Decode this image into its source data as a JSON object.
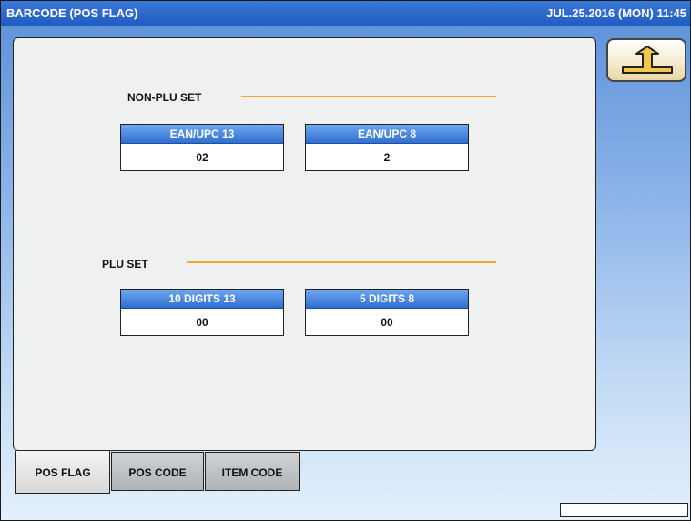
{
  "header": {
    "title": "BARCODE (POS FLAG)",
    "datetime": "JUL.25.2016 (MON)  11:45"
  },
  "non_plu": {
    "label": "NON-PLU SET",
    "fields": [
      {
        "label": "EAN/UPC 13",
        "value": "02"
      },
      {
        "label": "EAN/UPC 8",
        "value": "2"
      }
    ]
  },
  "plu": {
    "label": "PLU SET",
    "fields": [
      {
        "label": "10 DIGITS 13",
        "value": "00"
      },
      {
        "label": "5 DIGITS 8",
        "value": "00"
      }
    ]
  },
  "tabs": [
    {
      "label": "POS FLAG",
      "active": true
    },
    {
      "label": "POS CODE",
      "active": false
    },
    {
      "label": "ITEM CODE",
      "active": false
    }
  ],
  "icons": {
    "back": "return-arrow-icon"
  },
  "colors": {
    "title_bar": "#1f5bc0",
    "field_header": "#2f6fd0",
    "section_line": "#f0a830"
  }
}
